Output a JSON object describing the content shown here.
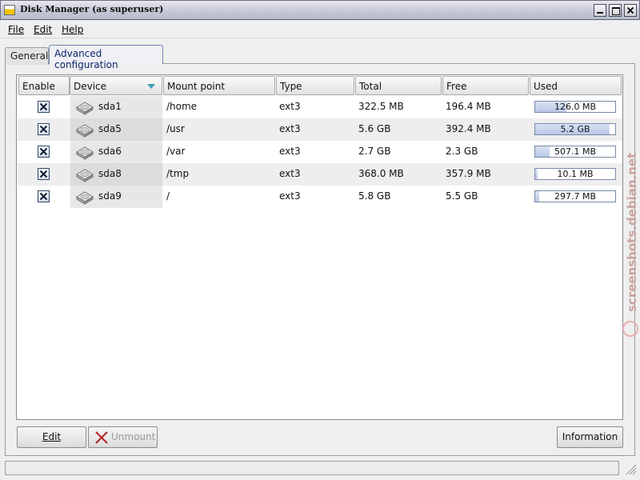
{
  "window": {
    "title": "Disk Manager (as superuser)"
  },
  "menu": {
    "file": "File",
    "edit": "Edit",
    "help": "Help"
  },
  "tabs": [
    {
      "label": "General",
      "active": false
    },
    {
      "label": "Advanced configuration",
      "active": true
    }
  ],
  "table": {
    "headers": [
      "Enable",
      "Device",
      "Mount point",
      "Type",
      "Total",
      "Free",
      "Used"
    ],
    "sort_column": "Device",
    "rows": [
      {
        "enabled": true,
        "device": "sda1",
        "mount": "/home",
        "type": "ext3",
        "total": "322.5 MB",
        "free": "196.4 MB",
        "used": "126.0 MB",
        "used_fraction": 0.39
      },
      {
        "enabled": true,
        "device": "sda5",
        "mount": "/usr",
        "type": "ext3",
        "total": "5.6 GB",
        "free": "392.4 MB",
        "used": "5.2 GB",
        "used_fraction": 0.93
      },
      {
        "enabled": true,
        "device": "sda6",
        "mount": "/var",
        "type": "ext3",
        "total": "2.7 GB",
        "free": "2.3 GB",
        "used": "507.1 MB",
        "used_fraction": 0.18
      },
      {
        "enabled": true,
        "device": "sda8",
        "mount": "/tmp",
        "type": "ext3",
        "total": "368.0 MB",
        "free": "357.9 MB",
        "used": "10.1 MB",
        "used_fraction": 0.03
      },
      {
        "enabled": true,
        "device": "sda9",
        "mount": "/",
        "type": "ext3",
        "total": "5.8 GB",
        "free": "5.5 GB",
        "used": "297.7 MB",
        "used_fraction": 0.05
      }
    ]
  },
  "buttons": {
    "edit": "Edit",
    "unmount": "Unmount",
    "information": "Information"
  },
  "watermark": "screenshots.debian.net",
  "icons": {
    "device": "harddisk-icon",
    "unmount": "red-x-icon",
    "app": "disk-manager-icon"
  },
  "colors": {
    "bar_fill": "#c3d0ea",
    "sort_arrow": "#3aa0b8",
    "active_tab_text": "#0a246a"
  }
}
